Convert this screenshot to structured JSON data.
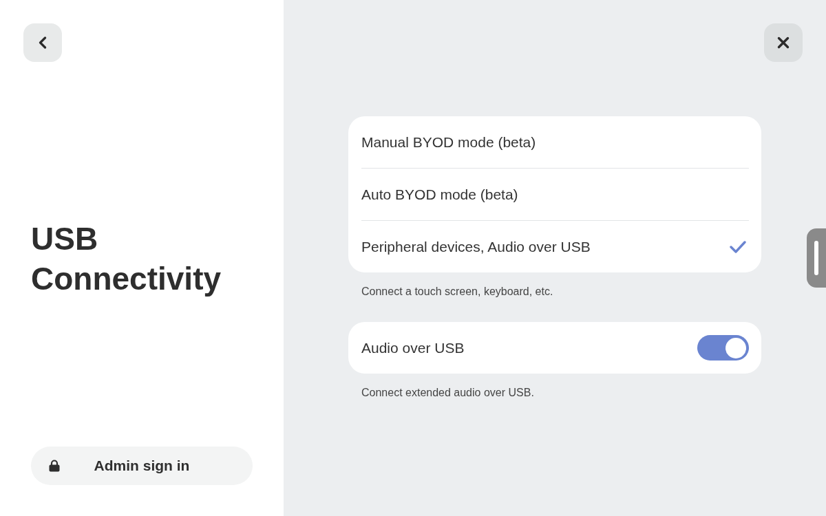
{
  "title": "USB Connectivity",
  "admin_button": {
    "label": "Admin sign in"
  },
  "options": [
    {
      "label": "Manual BYOD mode (beta)",
      "selected": false
    },
    {
      "label": "Auto BYOD mode (beta)",
      "selected": false
    },
    {
      "label": "Peripheral devices, Audio over USB",
      "selected": true
    }
  ],
  "options_hint": "Connect a touch screen, keyboard, etc.",
  "toggle_row": {
    "label": "Audio over USB",
    "on": true
  },
  "toggle_hint": "Connect extended audio over USB."
}
